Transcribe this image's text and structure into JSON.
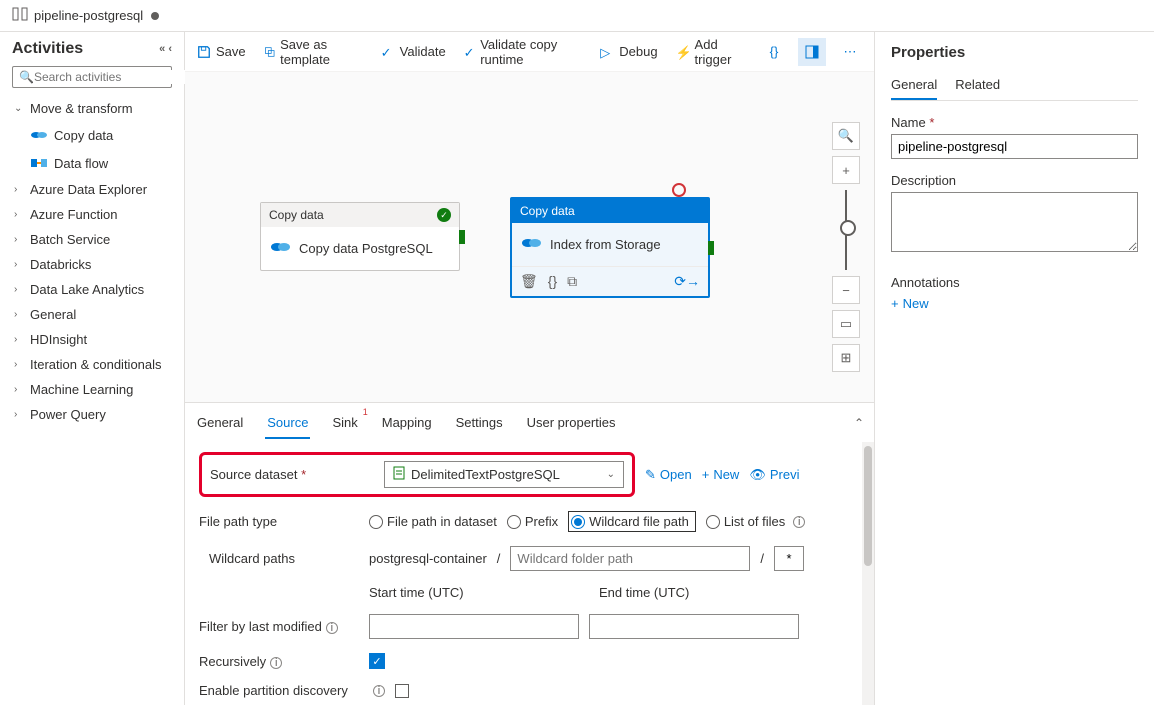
{
  "tab": {
    "title": "pipeline-postgresql"
  },
  "sidebar": {
    "title": "Activities",
    "search_placeholder": "Search activities",
    "group_move": "Move & transform",
    "items": {
      "copy_data": "Copy data",
      "data_flow": "Data flow"
    },
    "groups": [
      "Azure Data Explorer",
      "Azure Function",
      "Batch Service",
      "Databricks",
      "Data Lake Analytics",
      "General",
      "HDInsight",
      "Iteration & conditionals",
      "Machine Learning",
      "Power Query"
    ]
  },
  "toolbar": {
    "save": "Save",
    "save_tmpl": "Save as template",
    "validate": "Validate",
    "validate_copy": "Validate copy runtime",
    "debug": "Debug",
    "add_trigger": "Add trigger"
  },
  "canvas": {
    "node1": {
      "type": "Copy data",
      "title": "Copy data PostgreSQL"
    },
    "node2": {
      "type": "Copy data",
      "title": "Index from Storage"
    }
  },
  "tabs": {
    "general": "General",
    "source": "Source",
    "sink": "Sink",
    "mapping": "Mapping",
    "settings": "Settings",
    "user_props": "User properties"
  },
  "form": {
    "source_dataset_label": "Source dataset",
    "source_dataset_value": "DelimitedTextPostgreSQL",
    "open": "Open",
    "new": "New",
    "preview": "Previ",
    "file_path_type_label": "File path type",
    "fpt_options": {
      "in_dataset": "File path in dataset",
      "prefix": "Prefix",
      "wildcard": "Wildcard file path",
      "list": "List of files"
    },
    "wildcard_paths_label": "Wildcard paths",
    "wildcard_container": "postgresql-container",
    "wildcard_folder_placeholder": "Wildcard folder path",
    "wildcard_star": "*",
    "start_time": "Start time (UTC)",
    "end_time": "End time (UTC)",
    "filter_label": "Filter by last modified",
    "recursively": "Recursively",
    "partition": "Enable partition discovery"
  },
  "props": {
    "title": "Properties",
    "tabs": {
      "general": "General",
      "related": "Related"
    },
    "name_label": "Name",
    "name_value": "pipeline-postgresql",
    "desc_label": "Description",
    "annotations": "Annotations",
    "new": "New"
  }
}
